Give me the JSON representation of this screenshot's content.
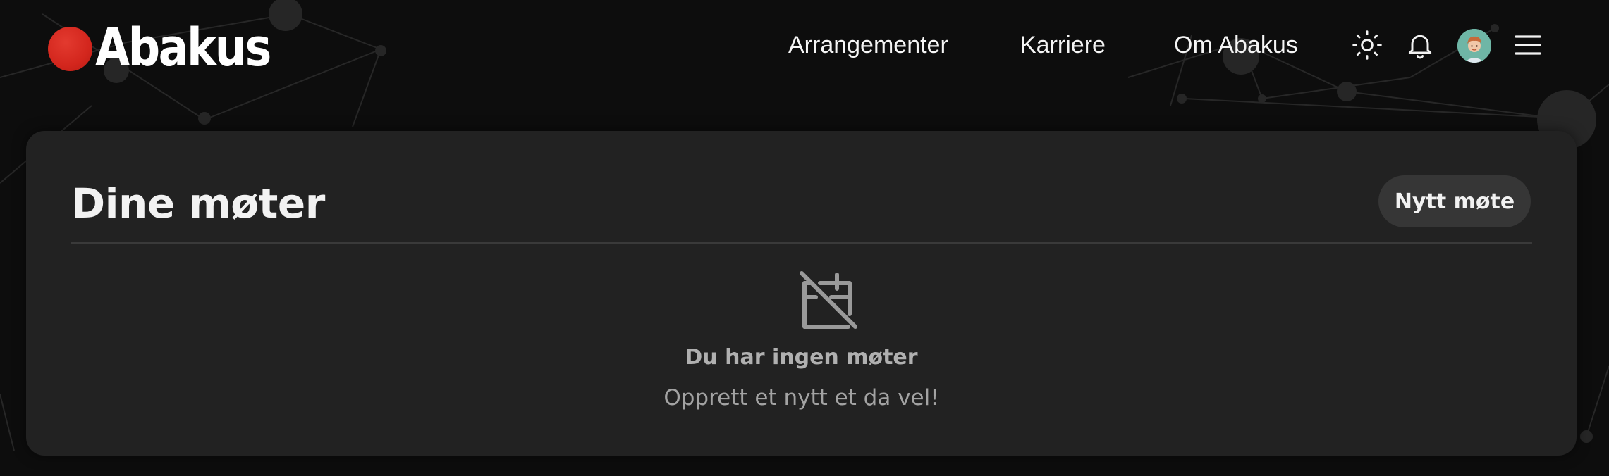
{
  "header": {
    "logo_text": "Abakus",
    "logo_color": "#d3261d",
    "nav": [
      {
        "label": "Arrangementer"
      },
      {
        "label": "Karriere"
      },
      {
        "label": "Om Abakus"
      }
    ],
    "icons": {
      "theme": "sun-icon",
      "notifications": "bell-icon",
      "avatar": "user-avatar",
      "menu": "hamburger-menu-icon"
    }
  },
  "main": {
    "title": "Dine møter",
    "new_meeting_label": "Nytt møte",
    "empty_state": {
      "icon": "calendar-off-icon",
      "title": "Du har ingen møter",
      "subtitle": "Opprett et nytt et da vel!"
    }
  },
  "colors": {
    "page_background": "#0d0d0d",
    "card_background": "#222222",
    "button_background": "#363636",
    "accent": "#d3261d"
  }
}
